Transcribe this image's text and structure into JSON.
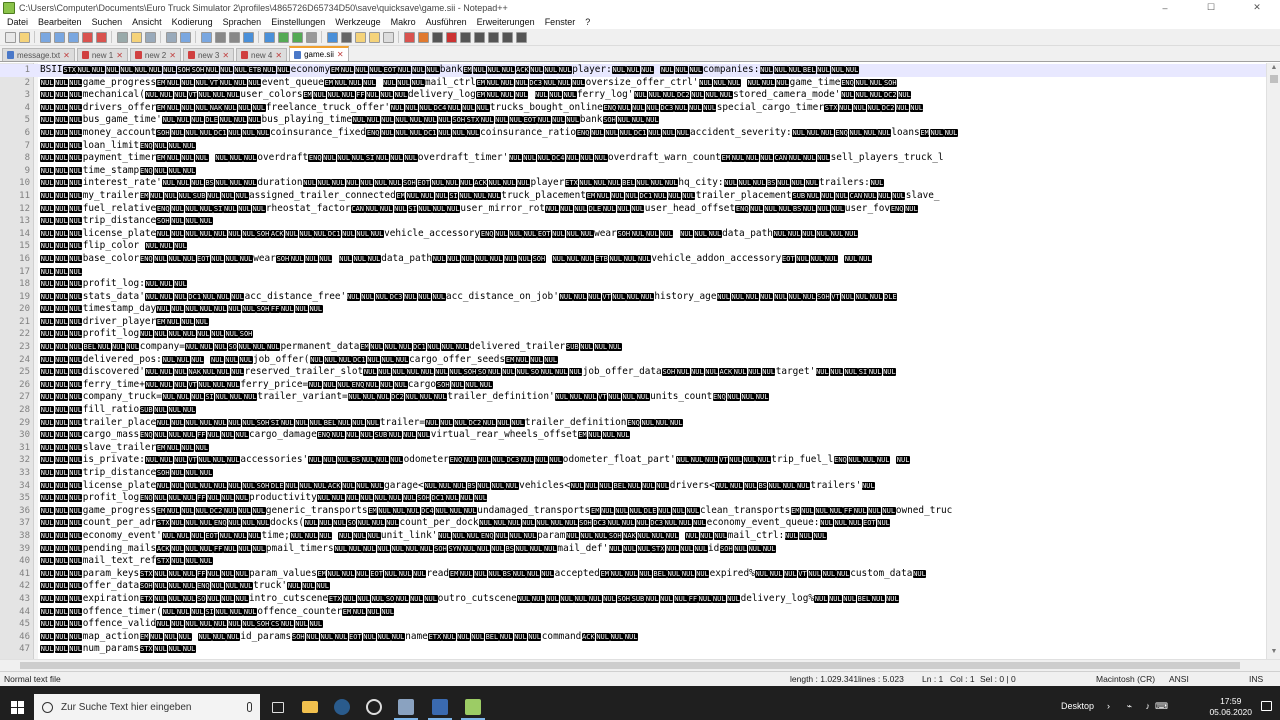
{
  "window": {
    "title": "C:\\Users\\Computer\\Documents\\Euro Truck Simulator 2\\profiles\\4865726D65734D50\\save\\quicksave\\game.sii - Notepad++",
    "minimize": "–",
    "maximize": "☐",
    "close": "✕"
  },
  "menu": [
    "Datei",
    "Bearbeiten",
    "Suchen",
    "Ansicht",
    "Kodierung",
    "Sprachen",
    "Einstellungen",
    "Werkzeuge",
    "Makro",
    "Ausführen",
    "Erweiterungen",
    "Fenster",
    "?"
  ],
  "tabs": [
    {
      "label": "message.txt",
      "active": false,
      "modified": false
    },
    {
      "label": "new 1",
      "active": false,
      "modified": true
    },
    {
      "label": "new 2",
      "active": false,
      "modified": true
    },
    {
      "label": "new 3",
      "active": false,
      "modified": true
    },
    {
      "label": "new 4",
      "active": false,
      "modified": true
    },
    {
      "label": "game.sii",
      "active": true,
      "modified": false
    }
  ],
  "editor": {
    "lines": [
      {
        "n": "1",
        "t": "BSII⟦STX⟧⟦NUL⟧⟦NUL⟧⟦NUL⟧⟦NUL⟧⟦NUL⟧⟦NUL⟧⟦NUL⟧⟦SOH⟧⟦SOH⟧⟦NUL⟧⟦NUL⟧⟦NUL⟧⟦ETB⟧⟦NUL⟧⟦NUL⟧economy⟦EM⟧⟦NUL⟧⟦NUL⟧⟦NUL⟧⟦EOT⟧⟦NUL⟧⟦NUL⟧⟦NUL⟧bank⟦EM⟧⟦NUL⟧⟦NUL⟧⟦NUL⟧⟦ACK⟧⟦NUL⟧⟦NUL⟧⟦NUL⟧player:⟦NUL⟧⟦NUL⟧⟦NUL⟧ ⟦NUL⟧⟦NUL⟧⟦NUL⟧companies:⟦NUL⟧⟦NUL⟧⟦NUL⟧⟦BEL⟧⟦NUL⟧⟦NUL⟧⟦NUL⟧",
        "current": true
      },
      {
        "n": "2",
        "t": "⟦NUL⟧⟦NUL⟧⟦NUL⟧game_progress⟦EM⟧⟦NUL⟧⟦NUL⟧⟦NUL⟧⟦VT⟧⟦NUL⟧⟦NUL⟧⟦NUL⟧event_queue⟦EM⟧⟦NUL⟧⟦NUL⟧⟦NUL⟧  ⟦NUL⟧⟦NUL⟧⟦NUL⟧mail_ctrl⟦EM⟧⟦NUL⟧⟦NUL⟧⟦NUL⟧⟦DC3⟧⟦NUL⟧⟦NUL⟧⟦NUL⟧oversize_offer_ctrl'⟦NUL⟧⟦NUL⟧⟦NUL⟧ ⟦NUL⟧⟦NUL⟧⟦NUL⟧game_time⟦ENQ⟧⟦NUL⟧⟦NUL⟧⟦SOH⟧",
        "current": false
      },
      {
        "n": "3",
        "t": "⟦NUL⟧⟦NUL⟧⟦NUL⟧mechanical(⟦NUL⟧⟦NUL⟧⟦NUL⟧⟦VT⟧⟦NUL⟧⟦NUL⟧⟦NUL⟧user_colors⟦EM⟧⟦NUL⟧⟦NUL⟧⟦NUL⟧⟦FF⟧⟦NUL⟧⟦NUL⟧⟦NUL⟧delivery_log⟦EM⟧⟦NUL⟧⟦NUL⟧⟦NUL⟧  ⟦NUL⟧⟦NUL⟧⟦NUL⟧ferry_log'⟦NUL⟧⟦NUL⟧⟦NUL⟧⟦DC2⟧⟦NUL⟧⟦NUL⟧⟦NUL⟧stored_camera_mode'⟦NUL⟧⟦NUL⟧⟦NUL⟧⟦DC2⟧⟦NUL⟧",
        "current": false
      },
      {
        "n": "4",
        "t": "⟦NUL⟧⟦NUL⟧⟦NUL⟧drivers_offer⟦EM⟧⟦NUL⟧⟦NUL⟧⟦NUL⟧⟦NAK⟧⟦NUL⟧⟦NUL⟧⟦NUL⟧freelance_truck_offer'⟦NUL⟧⟦NUL⟧⟦NUL⟧⟦DC4⟧⟦NUL⟧⟦NUL⟧⟦NUL⟧trucks_bought_online⟦ENQ⟧⟦NUL⟧⟦NUL⟧⟦NUL⟧⟦DC3⟧⟦NUL⟧⟦NUL⟧⟦NUL⟧special_cargo_timer⟦STX⟧⟦NUL⟧⟦NUL⟧⟦NUL⟧⟦DC2⟧⟦NUL⟧⟦NUL⟧",
        "current": false
      },
      {
        "n": "5",
        "t": "⟦NUL⟧⟦NUL⟧⟦NUL⟧bus_game_time'⟦NUL⟧⟦NUL⟧⟦NUL⟧⟦DLE⟧⟦NUL⟧⟦NUL⟧⟦NUL⟧bus_playing_time⟦NUL⟧⟦NUL⟧⟦NUL⟧⟦NUL⟧⟦NUL⟧⟦NUL⟧⟦NUL⟧⟦SOH⟧⟦STX⟧⟦NUL⟧⟦NUL⟧⟦NUL⟧⟦EOT⟧⟦NUL⟧⟦NUL⟧⟦NUL⟧bank⟦SOH⟧⟦NUL⟧⟦NUL⟧⟦NUL⟧",
        "current": false
      },
      {
        "n": "6",
        "t": "⟦NUL⟧⟦NUL⟧⟦NUL⟧money_account⟦SOH⟧⟦NUL⟧⟦NUL⟧⟦NUL⟧⟦DC1⟧⟦NUL⟧⟦NUL⟧⟦NUL⟧coinsurance_fixed⟦ENQ⟧⟦NUL⟧⟦NUL⟧⟦NUL⟧⟦DC1⟧⟦NUL⟧⟦NUL⟧⟦NUL⟧coinsurance_ratio⟦ENQ⟧⟦NUL⟧⟦NUL⟧⟦NUL⟧⟦DC1⟧⟦NUL⟧⟦NUL⟧⟦NUL⟧accident_severity:⟦NUL⟧⟦NUL⟧⟦NUL⟧⟦ENQ⟧⟦NUL⟧⟦NUL⟧⟦NUL⟧loans⟦EM⟧⟦NUL⟧⟦NUL⟧",
        "current": false
      },
      {
        "n": "7",
        "t": "⟦NUL⟧⟦NUL⟧⟦NUL⟧loan_limit⟦ENQ⟧⟦NUL⟧⟦NUL⟧⟦NUL⟧",
        "current": false
      },
      {
        "n": "8",
        "t": "⟦NUL⟧⟦NUL⟧⟦NUL⟧payment_timer⟦EM⟧⟦NUL⟧⟦NUL⟧⟦NUL⟧  ⟦NUL⟧⟦NUL⟧⟦NUL⟧overdraft⟦ENQ⟧⟦NUL⟧⟦NUL⟧⟦NUL⟧⟦SI⟧⟦NUL⟧⟦NUL⟧⟦NUL⟧overdraft_timer'⟦NUL⟧⟦NUL⟧⟦NUL⟧⟦DC4⟧⟦NUL⟧⟦NUL⟧⟦NUL⟧overdraft_warn_count⟦EM⟧⟦NUL⟧⟦NUL⟧⟦NUL⟧⟦CAN⟧⟦NUL⟧⟦NUL⟧⟦NUL⟧sell_players_truck_l",
        "current": false
      },
      {
        "n": "9",
        "t": "⟦NUL⟧⟦NUL⟧⟦NUL⟧time_stamp⟦ENQ⟧⟦NUL⟧⟦NUL⟧⟦NUL⟧",
        "current": false
      },
      {
        "n": "10",
        "t": "⟦NUL⟧⟦NUL⟧⟦NUL⟧interest_rate'⟦NUL⟧⟦NUL⟧⟦NUL⟧⟦BS⟧⟦NUL⟧⟦NUL⟧⟦NUL⟧duration⟦NUL⟧⟦NUL⟧⟦NUL⟧⟦NUL⟧⟦NUL⟧⟦NUL⟧⟦NUL⟧⟦SOH⟧⟦EOT⟧⟦NUL⟧⟦NUL⟧⟦NUL⟧⟦ACK⟧⟦NUL⟧⟦NUL⟧⟦NUL⟧player⟦ETX⟧⟦NUL⟧⟦NUL⟧⟦NUL⟧⟦BEL⟧⟦NUL⟧⟦NUL⟧⟦NUL⟧hq_city:⟦NUL⟧⟦NUL⟧⟦NUL⟧⟦BS⟧⟦NUL⟧⟦NUL⟧⟦NUL⟧trailers:⟦NUL⟧",
        "current": false
      },
      {
        "n": "11",
        "t": "⟦NUL⟧⟦NUL⟧⟦NUL⟧my_trailer⟦EM⟧⟦NUL⟧⟦NUL⟧⟦NUL⟧⟦SUB⟧⟦NUL⟧⟦NUL⟧⟦NUL⟧assigned_trailer_connected⟦EM⟧⟦NUL⟧⟦NUL⟧⟦NUL⟧⟦SI⟧⟦NUL⟧⟦NUL⟧⟦NUL⟧truck_placement⟦EM⟧⟦NUL⟧⟦NUL⟧⟦NUL⟧⟦DC1⟧⟦NUL⟧⟦NUL⟧⟦NUL⟧trailer_placement⟦SUB⟧⟦NUL⟧⟦NUL⟧⟦NUL⟧⟦CAN⟧⟦NUL⟧⟦NUL⟧⟦NUL⟧slave_",
        "current": false
      },
      {
        "n": "12",
        "t": "⟦NUL⟧⟦NUL⟧⟦NUL⟧fuel_relative⟦ENQ⟧⟦NUL⟧⟦NUL⟧⟦NUL⟧⟦SI⟧⟦NUL⟧⟦NUL⟧⟦NUL⟧rheostat_factor⟦CAN⟧⟦NUL⟧⟦NUL⟧⟦NUL⟧⟦SI⟧⟦NUL⟧⟦NUL⟧⟦NUL⟧user_mirror_rot⟦NUL⟧⟦NUL⟧⟦NUL⟧⟦DLE⟧⟦NUL⟧⟦NUL⟧⟦NUL⟧user_head_offset⟦ENQ⟧⟦NUL⟧⟦NUL⟧⟦NUL⟧⟦BS⟧⟦NUL⟧⟦NUL⟧⟦NUL⟧user_fov⟦ENQ⟧⟦NUL⟧",
        "current": false
      },
      {
        "n": "13",
        "t": "⟦NUL⟧⟦NUL⟧⟦NUL⟧trip_distance⟦SOH⟧⟦NUL⟧⟦NUL⟧⟦NUL⟧",
        "current": false
      },
      {
        "n": "14",
        "t": "⟦NUL⟧⟦NUL⟧⟦NUL⟧license_plate⟦NUL⟧⟦NUL⟧⟦NUL⟧⟦NUL⟧⟦NUL⟧⟦NUL⟧⟦NUL⟧⟦SOH⟧⟦ACK⟧⟦NUL⟧⟦NUL⟧⟦NUL⟧⟦DC1⟧⟦NUL⟧⟦NUL⟧⟦NUL⟧vehicle_accessory⟦ENQ⟧⟦NUL⟧⟦NUL⟧⟦NUL⟧⟦EOT⟧⟦NUL⟧⟦NUL⟧⟦NUL⟧wear⟦SOH⟧⟦NUL⟧⟦NUL⟧⟦NUL⟧ ⟦NUL⟧⟦NUL⟧⟦NUL⟧data_path⟦NUL⟧⟦NUL⟧⟦NUL⟧⟦NUL⟧⟦NUL⟧⟦NUL⟧",
        "current": false
      },
      {
        "n": "15",
        "t": "⟦NUL⟧⟦NUL⟧⟦NUL⟧flip_color    ⟦NUL⟧⟦NUL⟧⟦NUL⟧",
        "current": false
      },
      {
        "n": "16",
        "t": "⟦NUL⟧⟦NUL⟧⟦NUL⟧base_color⟦ENQ⟧⟦NUL⟧⟦NUL⟧⟦NUL⟧⟦EOT⟧⟦NUL⟧⟦NUL⟧⟦NUL⟧wear⟦SOH⟧⟦NUL⟧⟦NUL⟧⟦NUL⟧ ⟦NUL⟧⟦NUL⟧⟦NUL⟧data_path⟦NUL⟧⟦NUL⟧⟦NUL⟧⟦NUL⟧⟦NUL⟧⟦NUL⟧⟦NUL⟧⟦SOH⟧    ⟦NUL⟧⟦NUL⟧⟦NUL⟧⟦ETB⟧⟦NUL⟧⟦NUL⟧⟦NUL⟧vehicle_addon_accessory⟦EOT⟧⟦NUL⟧⟦NUL⟧⟦NUL⟧ ⟦NUL⟧⟦NUL⟧",
        "current": false
      },
      {
        "n": "17",
        "t": "⟦NUL⟧⟦NUL⟧⟦NUL⟧",
        "current": false
      },
      {
        "n": "18",
        "t": "⟦NUL⟧⟦NUL⟧⟦NUL⟧profit_log:⟦NUL⟧⟦NUL⟧⟦NUL⟧",
        "current": false
      },
      {
        "n": "19",
        "t": "⟦NUL⟧⟦NUL⟧⟦NUL⟧stats_data'⟦NUL⟧⟦NUL⟧⟦NUL⟧⟦DC1⟧⟦NUL⟧⟦NUL⟧⟦NUL⟧acc_distance_free'⟦NUL⟧⟦NUL⟧⟦NUL⟧⟦DC3⟧⟦NUL⟧⟦NUL⟧⟦NUL⟧acc_distance_on_job'⟦NUL⟧⟦NUL⟧⟦NUL⟧⟦VT⟧⟦NUL⟧⟦NUL⟧⟦NUL⟧history_age⟦NUL⟧⟦NUL⟧⟦NUL⟧⟦NUL⟧⟦NUL⟧⟦NUL⟧⟦NUL⟧⟦SOH⟧⟦VT⟧⟦NUL⟧⟦NUL⟧⟦NUL⟧⟦DLE⟧",
        "current": false
      },
      {
        "n": "20",
        "t": "⟦NUL⟧⟦NUL⟧⟦NUL⟧timestamp_day⟦NUL⟧⟦NUL⟧⟦NUL⟧⟦NUL⟧⟦NUL⟧⟦NUL⟧⟦NUL⟧⟦SOH⟧⟦FF⟧⟦NUL⟧⟦NUL⟧⟦NUL⟧",
        "current": false
      },
      {
        "n": "21",
        "t": "⟦NUL⟧⟦NUL⟧⟦NUL⟧driver_player⟦EM⟧⟦NUL⟧⟦NUL⟧⟦NUL⟧",
        "current": false
      },
      {
        "n": "22",
        "t": "⟦NUL⟧⟦NUL⟧⟦NUL⟧profit_log⟦NUL⟧⟦NUL⟧⟦NUL⟧⟦NUL⟧⟦NUL⟧⟦NUL⟧⟦NUL⟧⟦SOH⟧",
        "current": false
      },
      {
        "n": "23",
        "t": "⟦NUL⟧⟦NUL⟧⟦NUL⟧⟦BEL⟧⟦NUL⟧⟦NUL⟧⟦NUL⟧company=⟦NUL⟧⟦NUL⟧⟦NUL⟧⟦SO⟧⟦NUL⟧⟦NUL⟧⟦NUL⟧permanent_data⟦EM⟧⟦NUL⟧⟦NUL⟧⟦NUL⟧⟦DC1⟧⟦NUL⟧⟦NUL⟧⟦NUL⟧delivered_trailer⟦SUB⟧⟦NUL⟧⟦NUL⟧⟦NUL⟧",
        "current": false
      },
      {
        "n": "24",
        "t": "⟦NUL⟧⟦NUL⟧⟦NUL⟧delivered_pos:⟦NUL⟧⟦NUL⟧⟦NUL⟧  ⟦NUL⟧⟦NUL⟧⟦NUL⟧job_offer(⟦NUL⟧⟦NUL⟧⟦NUL⟧⟦DC1⟧⟦NUL⟧⟦NUL⟧⟦NUL⟧cargo_offer_seeds⟦EM⟧⟦NUL⟧⟦NUL⟧⟦NUL⟧",
        "current": false
      },
      {
        "n": "25",
        "t": "⟦NUL⟧⟦NUL⟧⟦NUL⟧discovered'⟦NUL⟧⟦NUL⟧⟦NUL⟧⟦NAK⟧⟦NUL⟧⟦NUL⟧⟦NUL⟧reserved_trailer_slot⟦NUL⟧⟦NUL⟧⟦NUL⟧⟦NUL⟧⟦NUL⟧⟦NUL⟧⟦NUL⟧⟦SOH⟧⟦SO⟧⟦NUL⟧⟦NUL⟧⟦NUL⟧⟦SO⟧⟦NUL⟧⟦NUL⟧⟦NUL⟧job_offer_data⟦SOH⟧⟦NUL⟧⟦NUL⟧⟦NUL⟧⟦ACK⟧⟦NUL⟧⟦NUL⟧⟦NUL⟧target'⟦NUL⟧⟦NUL⟧⟦NUL⟧⟦SI⟧⟦NUL⟧⟦NUL⟧",
        "current": false
      },
      {
        "n": "26",
        "t": "⟦NUL⟧⟦NUL⟧⟦NUL⟧ferry_time+⟦NUL⟧⟦NUL⟧⟦NUL⟧⟦VT⟧⟦NUL⟧⟦NUL⟧⟦NUL⟧ferry_price=⟦NUL⟧⟦NUL⟧⟦NUL⟧⟦ENQ⟧⟦NUL⟧⟦NUL⟧⟦NUL⟧cargo⟦SOH⟧⟦NUL⟧⟦NUL⟧⟦NUL⟧",
        "current": false
      },
      {
        "n": "27",
        "t": "⟦NUL⟧⟦NUL⟧⟦NUL⟧company_truck=⟦NUL⟧⟦NUL⟧⟦NUL⟧⟦SI⟧⟦NUL⟧⟦NUL⟧⟦NUL⟧trailer_variant=⟦NUL⟧⟦NUL⟧⟦NUL⟧⟦DC2⟧⟦NUL⟧⟦NUL⟧⟦NUL⟧trailer_definition'⟦NUL⟧⟦NUL⟧⟦NUL⟧⟦VT⟧⟦NUL⟧⟦NUL⟧⟦NUL⟧units_count⟦ENQ⟧⟦NUL⟧⟦NUL⟧⟦NUL⟧",
        "current": false
      },
      {
        "n": "28",
        "t": "⟦NUL⟧⟦NUL⟧⟦NUL⟧fill_ratio⟦SUB⟧⟦NUL⟧⟦NUL⟧⟦NUL⟧",
        "current": false
      },
      {
        "n": "29",
        "t": "⟦NUL⟧⟦NUL⟧⟦NUL⟧trailer_place⟦NUL⟧⟦NUL⟧⟦NUL⟧⟦NUL⟧⟦NUL⟧⟦NUL⟧⟦NUL⟧⟦SOH⟧⟦SI⟧⟦NUL⟧⟦NUL⟧⟦NUL⟧⟦BEL⟧⟦NUL⟧⟦NUL⟧⟦NUL⟧trailer=⟦NUL⟧⟦NUL⟧⟦NUL⟧⟦DC2⟧⟦NUL⟧⟦NUL⟧⟦NUL⟧trailer_definition⟦ENQ⟧⟦NUL⟧⟦NUL⟧⟦NUL⟧",
        "current": false
      },
      {
        "n": "30",
        "t": "⟦NUL⟧⟦NUL⟧⟦NUL⟧cargo_mass⟦ENQ⟧⟦NUL⟧⟦NUL⟧⟦NUL⟧⟦FF⟧⟦NUL⟧⟦NUL⟧⟦NUL⟧cargo_damage⟦ENQ⟧⟦NUL⟧⟦NUL⟧⟦NUL⟧⟦SUB⟧⟦NUL⟧⟦NUL⟧⟦NUL⟧virtual_rear_wheels_offset⟦EM⟧⟦NUL⟧⟦NUL⟧⟦NUL⟧",
        "current": false
      },
      {
        "n": "31",
        "t": "⟦NUL⟧⟦NUL⟧⟦NUL⟧slave_trailer⟦EM⟧⟦NUL⟧⟦NUL⟧⟦NUL⟧",
        "current": false
      },
      {
        "n": "32",
        "t": "⟦NUL⟧⟦NUL⟧⟦NUL⟧is_private:⟦NUL⟧⟦NUL⟧⟦NUL⟧⟦VT⟧⟦NUL⟧⟦NUL⟧⟦NUL⟧accessories'⟦NUL⟧⟦NUL⟧⟦NUL⟧⟦BS⟧⟦NUL⟧⟦NUL⟧⟦NUL⟧odometer⟦ENQ⟧⟦NUL⟧⟦NUL⟧⟦NUL⟧⟦DC3⟧⟦NUL⟧⟦NUL⟧⟦NUL⟧odometer_float_part'⟦NUL⟧⟦NUL⟧⟦NUL⟧⟦VT⟧⟦NUL⟧⟦NUL⟧⟦NUL⟧trip_fuel_l⟦ENQ⟧⟦NUL⟧⟦NUL⟧⟦NUL⟧ ⟦NUL⟧",
        "current": false
      },
      {
        "n": "33",
        "t": "⟦NUL⟧⟦NUL⟧⟦NUL⟧trip_distance⟦SOH⟧⟦NUL⟧⟦NUL⟧⟦NUL⟧",
        "current": false
      },
      {
        "n": "34",
        "t": "⟦NUL⟧⟦NUL⟧⟦NUL⟧license_plate⟦NUL⟧⟦NUL⟧⟦NUL⟧⟦NUL⟧⟦NUL⟧⟦NUL⟧⟦NUL⟧⟦SOH⟧⟦DLE⟧⟦NUL⟧⟦NUL⟧⟦NUL⟧⟦ACK⟧⟦NUL⟧⟦NUL⟧⟦NUL⟧garage&lt;⟦NUL⟧⟦NUL⟧⟦NUL⟧⟦BS⟧⟦NUL⟧⟦NUL⟧⟦NUL⟧vehicles&lt;⟦NUL⟧⟦NUL⟧⟦NUL⟧⟦BEL⟧⟦NUL⟧⟦NUL⟧⟦NUL⟧drivers&lt;⟦NUL⟧⟦NUL⟧⟦NUL⟧⟦BS⟧⟦NUL⟧⟦NUL⟧⟦NUL⟧trailers'⟦NUL⟧",
        "current": false
      },
      {
        "n": "35",
        "t": "⟦NUL⟧⟦NUL⟧⟦NUL⟧profit_log⟦ENQ⟧⟦NUL⟧⟦NUL⟧⟦NUL⟧⟦FF⟧⟦NUL⟧⟦NUL⟧⟦NUL⟧productivity⟦NUL⟧⟦NUL⟧⟦NUL⟧⟦NUL⟧⟦NUL⟧⟦NUL⟧⟦NUL⟧⟦SOH⟧⟦DC1⟧⟦NUL⟧⟦NUL⟧⟦NUL⟧",
        "current": false
      },
      {
        "n": "36",
        "t": "⟦NUL⟧⟦NUL⟧⟦NUL⟧game_progress⟦EM⟧⟦NUL⟧⟦NUL⟧⟦NUL⟧⟦DC2⟧⟦NUL⟧⟦NUL⟧⟦NUL⟧generic_transports⟦EM⟧⟦NUL⟧⟦NUL⟧⟦NUL⟧⟦DC4⟧⟦NUL⟧⟦NUL⟧⟦NUL⟧undamaged_transports⟦EM⟧⟦NUL⟧⟦NUL⟧⟦NUL⟧⟦DLE⟧⟦NUL⟧⟦NUL⟧⟦NUL⟧clean_transports⟦EM⟧⟦NUL⟧⟦NUL⟧⟦NUL⟧⟦FF⟧⟦NUL⟧⟦NUL⟧⟦NUL⟧owned_truc",
        "current": false
      },
      {
        "n": "37",
        "t": "⟦NUL⟧⟦NUL⟧⟦NUL⟧count_per_adr⟦STX⟧⟦NUL⟧⟦NUL⟧⟦NUL⟧⟦ENQ⟧⟦NUL⟧⟦NUL⟧⟦NUL⟧docks(⟦NUL⟧⟦NUL⟧⟦NUL⟧⟦SO⟧⟦NUL⟧⟦NUL⟧⟦NUL⟧count_per_dock⟦NUL⟧⟦NUL⟧⟦NUL⟧⟦NUL⟧⟦NUL⟧⟦NUL⟧⟦NUL⟧⟦SOH⟧⟦DC3⟧⟦NUL⟧⟦NUL⟧⟦NUL⟧⟦DC3⟧⟦NUL⟧⟦NUL⟧⟦NUL⟧economy_event_queue:⟦NUL⟧⟦NUL⟧⟦NUL⟧⟦EOT⟧⟦NUL⟧",
        "current": false
      },
      {
        "n": "38",
        "t": "⟦NUL⟧⟦NUL⟧⟦NUL⟧economy_event'⟦NUL⟧⟦NUL⟧⟦NUL⟧⟦EOT⟧⟦NUL⟧⟦NUL⟧⟦NUL⟧time;⟦NUL⟧⟦NUL⟧⟦NUL⟧  ⟦NUL⟧⟦NUL⟧⟦NUL⟧unit_link'⟦NUL⟧⟦NUL⟧⟦NUL⟧⟦ENQ⟧⟦NUL⟧⟦NUL⟧⟦NUL⟧param⟦NUL⟧⟦NUL⟧⟦NUL⟧⟦SOH⟧⟦NAK⟧⟦NUL⟧⟦NUL⟧⟦NUL⟧ ⟦NUL⟧⟦NUL⟧⟦NUL⟧mail_ctrl:⟦NUL⟧⟦NUL⟧⟦NUL⟧",
        "current": false
      },
      {
        "n": "39",
        "t": "⟦NUL⟧⟦NUL⟧⟦NUL⟧pending_mails⟦ACK⟧⟦NUL⟧⟦NUL⟧⟦NUL⟧⟦FF⟧⟦NUL⟧⟦NUL⟧⟦NUL⟧pmail_timers⟦NUL⟧⟦NUL⟧⟦NUL⟧⟦NUL⟧⟦NUL⟧⟦NUL⟧⟦NUL⟧⟦SOH⟧⟦SYN⟧⟦NUL⟧⟦NUL⟧⟦NUL⟧⟦BS⟧⟦NUL⟧⟦NUL⟧⟦NUL⟧mail_def'⟦NUL⟧⟦NUL⟧⟦NUL⟧⟦STX⟧⟦NUL⟧⟦NUL⟧⟦NUL⟧id⟦SOH⟧⟦NUL⟧⟦NUL⟧⟦NUL⟧",
        "current": false
      },
      {
        "n": "40",
        "t": "⟦NUL⟧⟦NUL⟧⟦NUL⟧mail_text_ref⟦STX⟧⟦NUL⟧⟦NUL⟧⟦NUL⟧",
        "current": false
      },
      {
        "n": "41",
        "t": "⟦NUL⟧⟦NUL⟧⟦NUL⟧param_keys⟦STX⟧⟦NUL⟧⟦NUL⟧⟦NUL⟧⟦FF⟧⟦NUL⟧⟦NUL⟧⟦NUL⟧param_values⟦EM⟧⟦NUL⟧⟦NUL⟧⟦NUL⟧⟦EOT⟧⟦NUL⟧⟦NUL⟧⟦NUL⟧read⟦EM⟧⟦NUL⟧⟦NUL⟧⟦NUL⟧⟦BS⟧⟦NUL⟧⟦NUL⟧⟦NUL⟧accepted⟦EM⟧⟦NUL⟧⟦NUL⟧⟦NUL⟧⟦BEL⟧⟦NUL⟧⟦NUL⟧⟦NUL⟧expired%⟦NUL⟧⟦NUL⟧⟦NUL⟧⟦VT⟧⟦NUL⟧⟦NUL⟧⟦NUL⟧custom_data⟦NUL⟧",
        "current": false
      },
      {
        "n": "42",
        "t": "⟦NUL⟧⟦NUL⟧⟦NUL⟧offer_data⟦SOH⟧⟦NUL⟧⟦NUL⟧⟦NUL⟧⟦ENQ⟧⟦NUL⟧⟦NUL⟧⟦NUL⟧truck'⟦NUL⟧⟦NUL⟧⟦NUL⟧",
        "current": false
      },
      {
        "n": "43",
        "t": "⟦NUL⟧⟦NUL⟧⟦NUL⟧expiration⟦ETX⟧⟦NUL⟧⟦NUL⟧⟦NUL⟧⟦SO⟧⟦NUL⟧⟦NUL⟧⟦NUL⟧intro_cutscene⟦ETX⟧⟦NUL⟧⟦NUL⟧⟦NUL⟧⟦SO⟧⟦NUL⟧⟦NUL⟧⟦NUL⟧outro_cutscene⟦NUL⟧⟦NUL⟧⟦NUL⟧⟦NUL⟧⟦NUL⟧⟦NUL⟧⟦NUL⟧⟦SOH⟧⟦SUB⟧⟦NUL⟧⟦NUL⟧⟦NUL⟧⟦FF⟧⟦NUL⟧⟦NUL⟧⟦NUL⟧delivery_log%⟦NUL⟧⟦NUL⟧⟦NUL⟧⟦BEL⟧⟦NUL⟧⟦NUL⟧",
        "current": false
      },
      {
        "n": "44",
        "t": "⟦NUL⟧⟦NUL⟧⟦NUL⟧offence_timer(⟦NUL⟧⟦NUL⟧⟦NUL⟧⟦SI⟧⟦NUL⟧⟦NUL⟧⟦NUL⟧offence_counter⟦EM⟧⟦NUL⟧⟦NUL⟧⟦NUL⟧",
        "current": false
      },
      {
        "n": "45",
        "t": "⟦NUL⟧⟦NUL⟧⟦NUL⟧offence_valid⟦NUL⟧⟦NUL⟧⟦NUL⟧⟦NUL⟧⟦NUL⟧⟦NUL⟧⟦NUL⟧⟦SOH⟧⟦CS⟧⟦NUL⟧⟦NUL⟧⟦NUL⟧",
        "current": false
      },
      {
        "n": "46",
        "t": "⟦NUL⟧⟦NUL⟧⟦NUL⟧map_action⟦EM⟧⟦NUL⟧⟦NUL⟧⟦NUL⟧  ⟦NUL⟧⟦NUL⟧⟦NUL⟧id_params⟦SOH⟧⟦NUL⟧⟦NUL⟧⟦NUL⟧⟦EOT⟧⟦NUL⟧⟦NUL⟧⟦NUL⟧name⟦ETX⟧⟦NUL⟧⟦NUL⟧⟦NUL⟧⟦BEL⟧⟦NUL⟧⟦NUL⟧⟦NUL⟧command⟦ACK⟧⟦NUL⟧⟦NUL⟧⟦NUL⟧",
        "current": false
      },
      {
        "n": "47",
        "t": "⟦NUL⟧⟦NUL⟧⟦NUL⟧num_params⟦STX⟧⟦NUL⟧⟦NUL⟧⟦NUL⟧",
        "current": false
      }
    ]
  },
  "status": {
    "file_type": "Normal text file",
    "length": "length : 1.029.341",
    "lines": "lines : 5.023",
    "ln": "Ln : 1",
    "col": "Col : 1",
    "sel": "Sel : 0 | 0",
    "eol": "Macintosh (CR)",
    "encoding": "ANSI",
    "mode": "INS"
  },
  "taskbar": {
    "search_placeholder": "Zur Suche Text hier eingeben",
    "desktop_label": "Desktop",
    "time": "17:59",
    "date": "05.06.2020"
  },
  "colors": {
    "control_char_bg": "#000000",
    "control_char_fg": "#ffffff",
    "current_line": "#e8e8ff",
    "taskbar_bg": "#1f1f1f",
    "active_tab_accent": "#f0a030"
  }
}
